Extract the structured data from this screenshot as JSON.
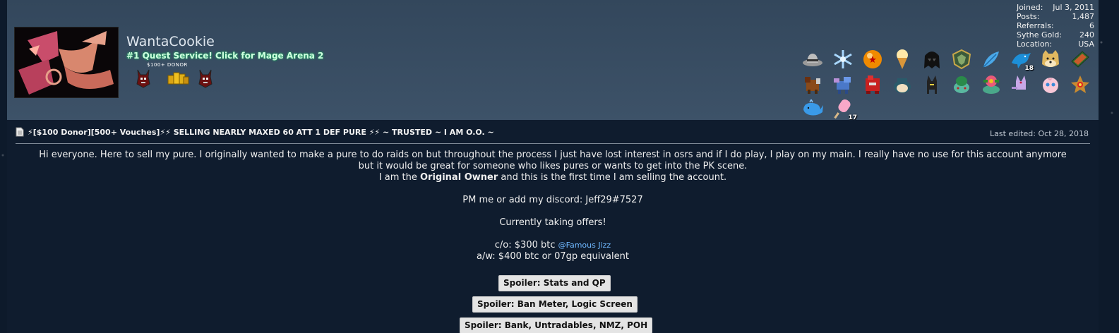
{
  "user": {
    "username": "WantaCookie",
    "usertitle": "#1 Quest Service! Click for Mage Arena 2",
    "donor_label": "$100+  DONOR"
  },
  "stats": [
    {
      "label": "Joined:",
      "value": "Jul 3, 2011"
    },
    {
      "label": "Posts:",
      "value": "1,487"
    },
    {
      "label": "Referrals:",
      "value": "6"
    },
    {
      "label": "Sythe Gold:",
      "value": "240"
    },
    {
      "label": "Location:",
      "value": "USA"
    }
  ],
  "awards": {
    "row1": [
      "fedora-icon",
      "snowflake-icon",
      "dragon-ball-icon",
      "ice-cream-icon",
      "darth-vader-icon",
      "league-badge-icon",
      "feather-icon",
      "dolphin-icon",
      "doge-icon",
      "notebook-icon"
    ],
    "row2": [
      "pokemon-entei-icon",
      "pokemon-suicune-icon",
      "pokemon-groudon-icon",
      "pokemon-snorlax-icon",
      "pokemon-umbreon-icon",
      "pokemon-bulbasaur-icon",
      "pokemon-venusaur-icon",
      "pokemon-espeon-icon",
      "pokemon-jigglypuff-icon",
      "pokemon-staryu-icon"
    ],
    "row3": [
      "whale-icon",
      "popsicle-icon"
    ],
    "dolphin_count": "18",
    "popsicle_count": "17"
  },
  "thread": {
    "title": "⚡[$100 Donor][500+ Vouches]⚡⚡ SELLING NEARLY MAXED 60 ATT 1 DEF PURE ⚡⚡ ~ TRUSTED ~ I AM O.O. ~",
    "last_edited": "Last edited: Oct 28, 2018"
  },
  "body": {
    "para1_line1": "Hi everyone. Here to sell my pure. I originally wanted to make a pure to do raids on but throughout the process I just have lost interest in osrs and if I do play, I play on my main. I really have no use for this account anymore",
    "para1_line2": "but it would be great for someone who likes pures or wants to get into the PK scene.",
    "owner_prefix": "I am the",
    "owner_bold": "Original Owner",
    "owner_suffix": "and this is the first time I am selling the account.",
    "contact": "PM me or add my discord: Jeff29#7527",
    "offers": "Currently taking offers!",
    "co": "c/o: $300 btc",
    "co_mention": "@Famous Jizz",
    "aw": "a/w: $400 btc or 07gp equivalent"
  },
  "spoilers": [
    "Spoiler: Stats and QP",
    "Spoiler: Ban Meter, Logic Screen",
    "Spoiler: Bank, Untradables, NMZ, POH"
  ],
  "colors": {
    "header_bg": "#3a4f65",
    "content_bg": "#0f1c2e",
    "title_glow": "#1fa060",
    "mention": "#6fb8ff"
  }
}
